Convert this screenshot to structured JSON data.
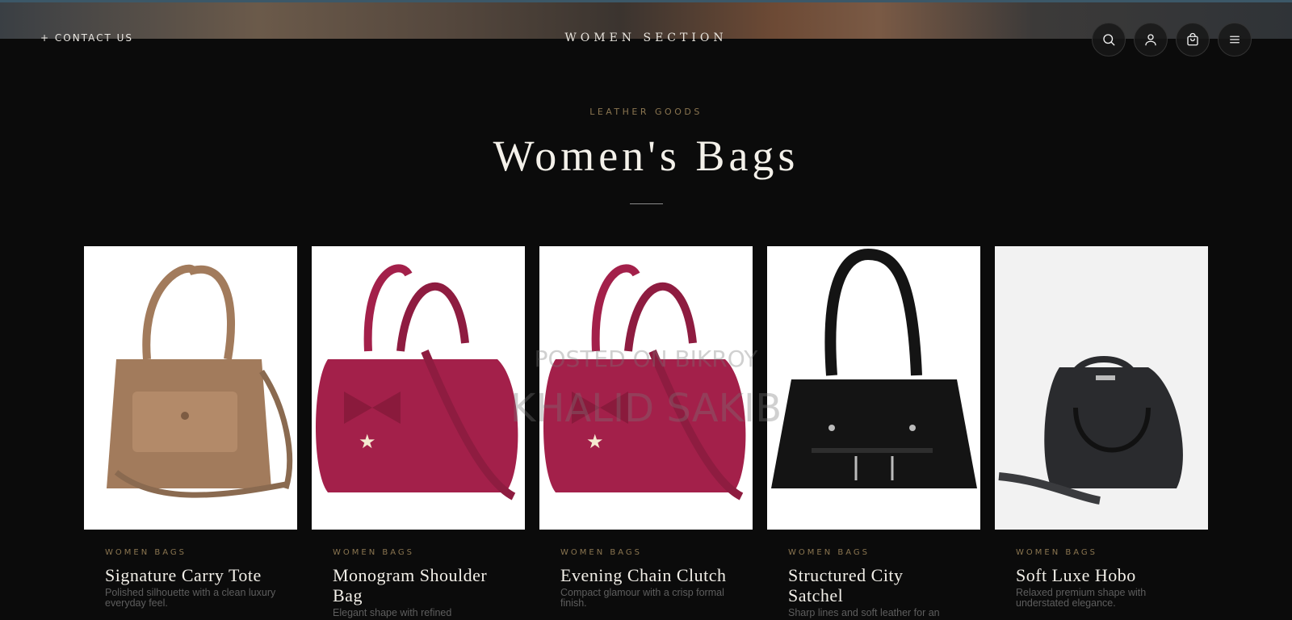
{
  "header": {
    "contact_label": "+ CONTACT US",
    "site_title": "WOMEN SECTION",
    "icons": [
      "search-icon",
      "user-icon",
      "bag-icon",
      "menu-icon"
    ]
  },
  "section": {
    "eyebrow": "LEATHER GOODS",
    "title": "Women's Bags"
  },
  "products": [
    {
      "category": "WOMEN BAGS",
      "name": "Signature Carry Tote",
      "description": "Polished silhouette with a clean luxury everyday feel.",
      "color": "#a27b5c"
    },
    {
      "category": "WOMEN BAGS",
      "name": "Monogram Shoulder Bag",
      "description": "Elegant shape with refined",
      "color": "#a3204a"
    },
    {
      "category": "WOMEN BAGS",
      "name": "Evening Chain Clutch",
      "description": "Compact glamour with a crisp formal finish.",
      "color": "#a3204a"
    },
    {
      "category": "WOMEN BAGS",
      "name": "Structured City Satchel",
      "description": "Sharp lines and soft leather for an",
      "color": "#141414"
    },
    {
      "category": "WOMEN BAGS",
      "name": "Soft Luxe Hobo",
      "description": "Relaxed premium shape with understated elegance.",
      "color": "#2a2b2e"
    }
  ],
  "watermark": {
    "line1": "POSTED ON BIKROY",
    "line2": "KHALID SAKIB"
  }
}
